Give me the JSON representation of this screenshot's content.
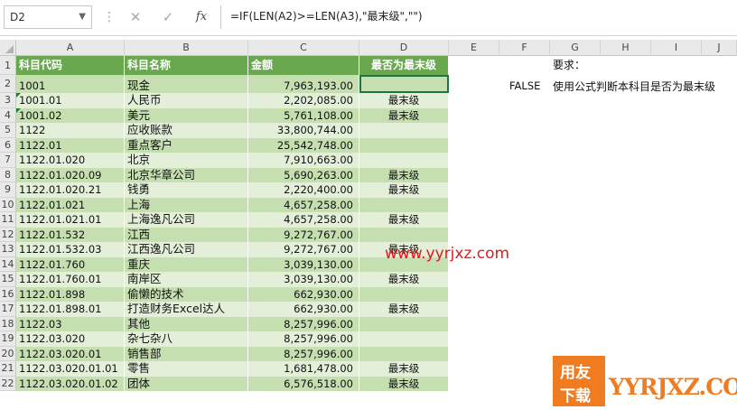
{
  "toolbar": {
    "name_box": "D2",
    "separator_icon": "⋮",
    "cancel_icon": "✕",
    "enter_icon": "✓",
    "fx_label": "fx",
    "formula": "=IF(LEN(A2)>=LEN(A3),\"最末级\",\"\")"
  },
  "columns": [
    "A",
    "B",
    "C",
    "D",
    "E",
    "F",
    "G",
    "H",
    "I",
    "J"
  ],
  "header": {
    "a": "科目代码",
    "b": "科目名称",
    "c": "金额",
    "d": "最否为最末级"
  },
  "rows": [
    {
      "n": "2",
      "a": "1001",
      "b": "现金",
      "c": "7,963,193.00",
      "d": "",
      "flag": false
    },
    {
      "n": "3",
      "a": "1001.01",
      "b": "人民币",
      "c": "2,202,085.00",
      "d": "最末级",
      "flag": true
    },
    {
      "n": "4",
      "a": "1001.02",
      "b": "美元",
      "c": "5,761,108.00",
      "d": "最末级",
      "flag": true
    },
    {
      "n": "5",
      "a": "1122",
      "b": "应收账款",
      "c": "33,800,744.00",
      "d": "",
      "flag": false
    },
    {
      "n": "6",
      "a": "1122.01",
      "b": "重点客户",
      "c": "25,542,748.00",
      "d": "",
      "flag": false
    },
    {
      "n": "7",
      "a": "1122.01.020",
      "b": "北京",
      "c": "7,910,663.00",
      "d": "",
      "flag": false
    },
    {
      "n": "8",
      "a": "1122.01.020.09",
      "b": "北京华章公司",
      "c": "5,690,263.00",
      "d": "最末级",
      "flag": false
    },
    {
      "n": "9",
      "a": "1122.01.020.21",
      "b": "钱勇",
      "c": "2,220,400.00",
      "d": "最末级",
      "flag": false
    },
    {
      "n": "10",
      "a": "1122.01.021",
      "b": "上海",
      "c": "4,657,258.00",
      "d": "",
      "flag": false
    },
    {
      "n": "11",
      "a": "1122.01.021.01",
      "b": "上海逸凡公司",
      "c": "4,657,258.00",
      "d": "最末级",
      "flag": false
    },
    {
      "n": "12",
      "a": "1122.01.532",
      "b": "江西",
      "c": "9,272,767.00",
      "d": "",
      "flag": false
    },
    {
      "n": "13",
      "a": "1122.01.532.03",
      "b": "江西逸凡公司",
      "c": "9,272,767.00",
      "d": "最末级",
      "flag": false
    },
    {
      "n": "14",
      "a": "1122.01.760",
      "b": "重庆",
      "c": "3,039,130.00",
      "d": "",
      "flag": false
    },
    {
      "n": "15",
      "a": "1122.01.760.01",
      "b": "南岸区",
      "c": "3,039,130.00",
      "d": "最末级",
      "flag": false
    },
    {
      "n": "16",
      "a": "1122.01.898",
      "b": "偷懒的技术",
      "c": "662,930.00",
      "d": "",
      "flag": false
    },
    {
      "n": "17",
      "a": "1122.01.898.01",
      "b": "打造财务Excel达人",
      "c": "662,930.00",
      "d": "最末级",
      "flag": false
    },
    {
      "n": "18",
      "a": "1122.03",
      "b": "其他",
      "c": "8,257,996.00",
      "d": "",
      "flag": false
    },
    {
      "n": "19",
      "a": "1122.03.020",
      "b": "杂七杂八",
      "c": "8,257,996.00",
      "d": "",
      "flag": false
    },
    {
      "n": "20",
      "a": "1122.03.020.01",
      "b": "销售部",
      "c": "8,257,996.00",
      "d": "",
      "flag": false
    },
    {
      "n": "21",
      "a": "1122.03.020.01.01",
      "b": "零售",
      "c": "1,681,478.00",
      "d": "最末级",
      "flag": false
    },
    {
      "n": "22",
      "a": "1122.03.020.01.02",
      "b": "团体",
      "c": "6,576,518.00",
      "d": "最末级",
      "flag": false
    }
  ],
  "notes": {
    "requirement_label": "要求：",
    "f2_value": "FALSE",
    "requirement_text": "使用公式判断本科目是否为最末级"
  },
  "watermark": {
    "url": "www.yyrjxz.com",
    "logo_top": "用友",
    "logo_bottom": "下载",
    "brand": "YYRJXZ.COM"
  },
  "colors": {
    "header_green": "#6aa84f",
    "band_dark": "#c5dfb1",
    "band_light": "#e3efd9",
    "watermark_red": "#e8161b",
    "logo_orange": "#f07c21"
  }
}
